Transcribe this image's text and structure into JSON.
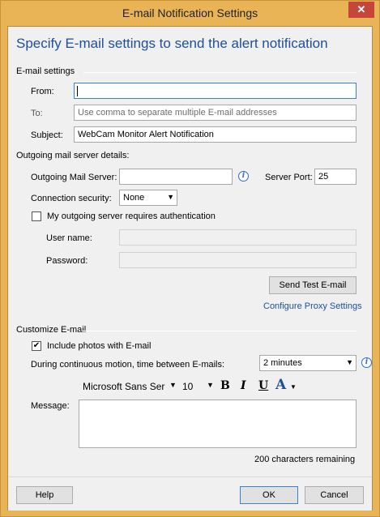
{
  "window": {
    "title": "E-mail Notification Settings",
    "close": "✕"
  },
  "heading": "Specify E-mail settings to send the alert notification",
  "email_settings": {
    "group_label": "E-mail settings",
    "from_label": "From:",
    "from_value": "",
    "to_label": "To:",
    "to_placeholder": "Use comma to separate multiple E-mail addresses",
    "subject_label": "Subject:",
    "subject_value": "WebCam Monitor Alert Notification"
  },
  "server": {
    "group_label": "Outgoing mail server details:",
    "server_label": "Outgoing Mail Server:",
    "server_value": "",
    "port_label": "Server Port:",
    "port_value": "25",
    "security_label": "Connection security:",
    "security_value": "None",
    "auth_label": "My outgoing server requires authentication",
    "auth_checked": false,
    "username_label": "User name:",
    "password_label": "Password:",
    "send_test_label": "Send Test E-mail",
    "proxy_link": "Configure Proxy Settings"
  },
  "customize": {
    "group_label": "Customize E-mail",
    "include_photos_label": "Include photos with E-mail",
    "include_photos_checked": true,
    "interval_label": "During continuous motion, time between E-mails:",
    "interval_value": "2 minutes",
    "font_name": "Microsoft Sans Ser",
    "font_size": "10",
    "bold": "B",
    "italic": "I",
    "underline": "U",
    "color": "A",
    "message_label": "Message:",
    "chars_remaining": "200 characters remaining"
  },
  "footer": {
    "help": "Help",
    "ok": "OK",
    "cancel": "Cancel"
  },
  "colors": {
    "accent": "#1e4f9c",
    "frame": "#e9b455",
    "close": "#c7463a"
  }
}
